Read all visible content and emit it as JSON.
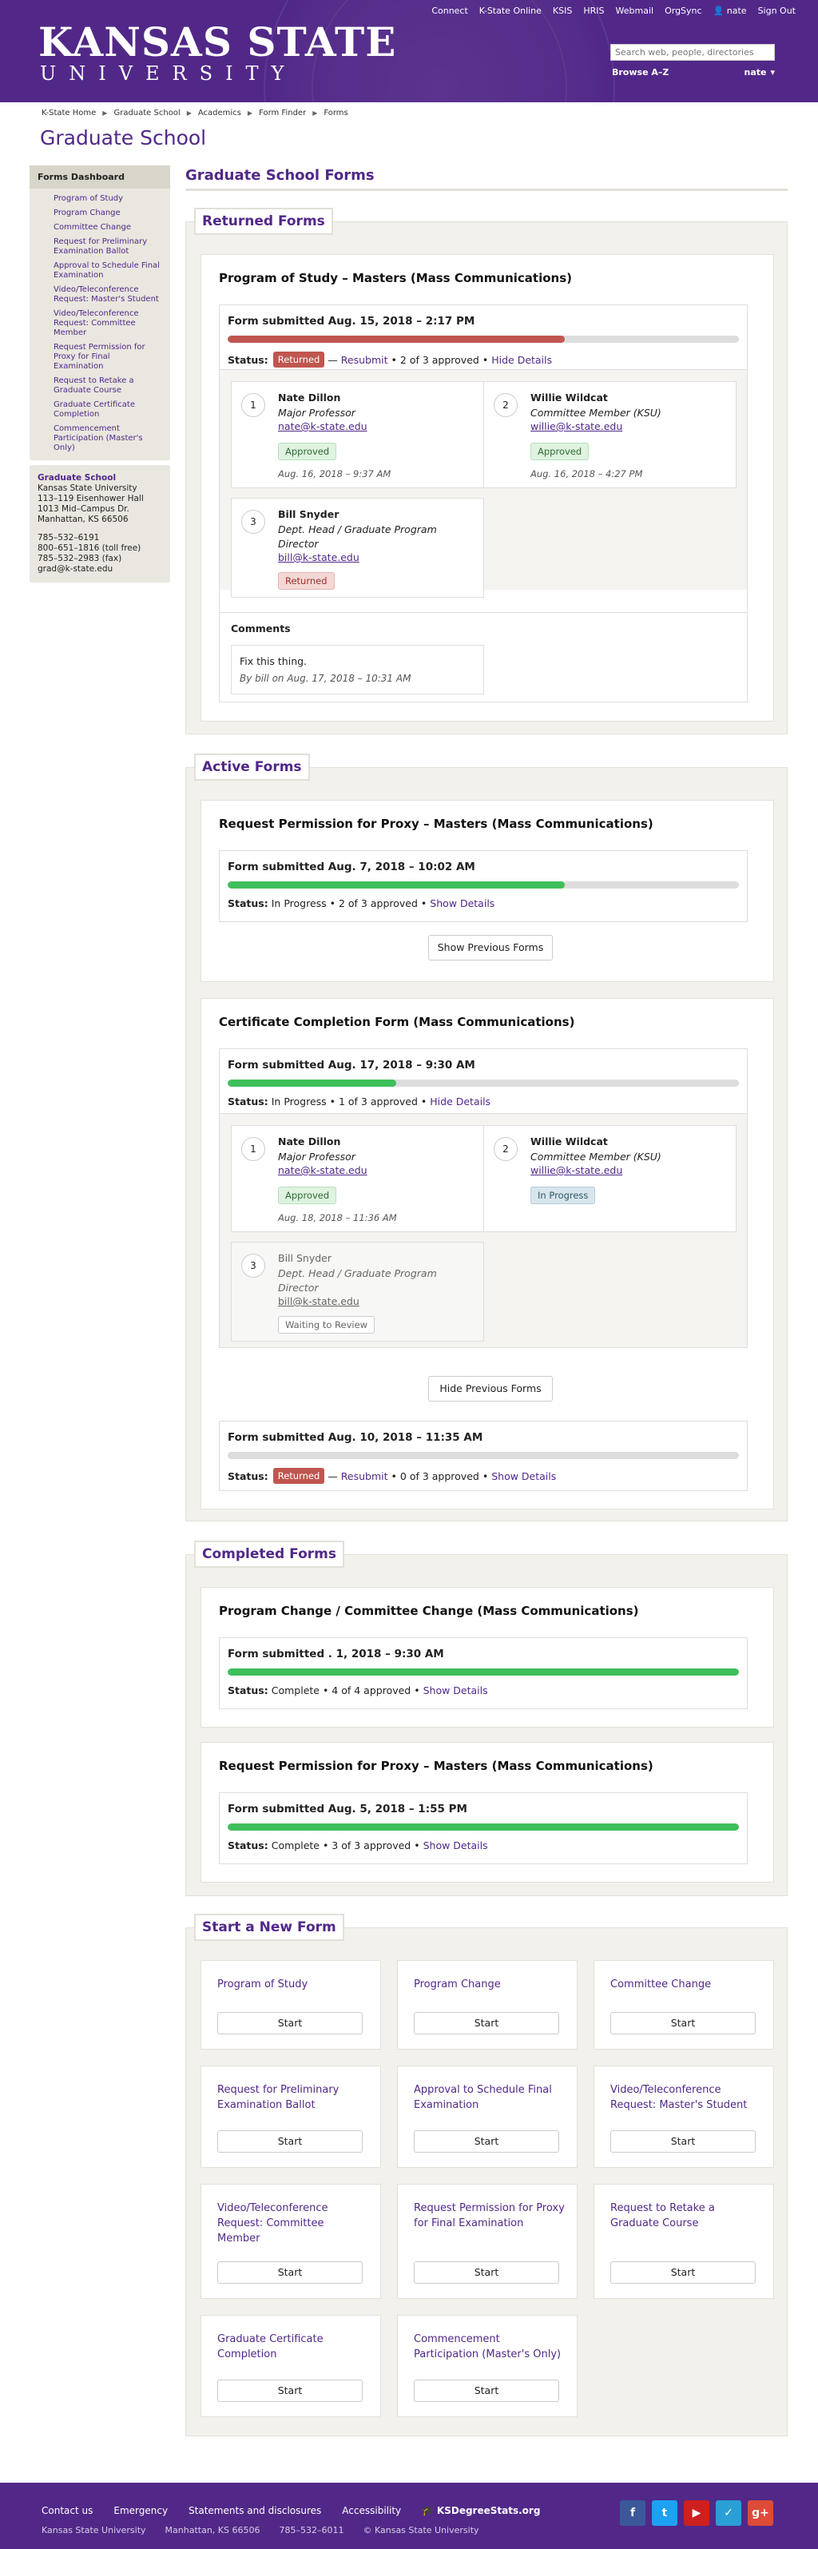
{
  "header": {
    "util_links": [
      "Connect",
      "K-State Online",
      "KSIS",
      "HRIS",
      "Webmail",
      "OrgSync"
    ],
    "user": "nate",
    "sign_out": "Sign Out",
    "logo_line1": "KANSAS STATE",
    "logo_line2": "UNIVERSITY",
    "search_placeholder": "Search web, people, directories",
    "browse": "Browse A–Z",
    "user_menu": "nate"
  },
  "breadcrumb": [
    "K-State Home",
    "Graduate School",
    "Academics",
    "Form Finder",
    "Forms"
  ],
  "site_title": "Graduate School",
  "sidebar": {
    "heading": "Forms Dashboard",
    "items": [
      "Program of Study",
      "Program Change",
      "Committee Change",
      "Request for Preliminary Examination Ballot",
      "Approval to Schedule Final Examination",
      "Video/Teleconference Request: Master's Student",
      "Video/Teleconference Request: Committee Member",
      "Request Permission for Proxy for Final Examination",
      "Request to Retake a Graduate Course",
      "Graduate Certificate Completion",
      "Commencement Participation (Master's Only)"
    ],
    "contact_title": "Graduate School",
    "contact_lines": [
      "Kansas State University",
      "113–119 Eisenhower Hall",
      "1013 Mid–Campus Dr.",
      "Manhattan, KS 66506",
      "",
      "785–532–6191",
      "800–651–1816 (toll free)",
      "785–532–2983 (fax)",
      "grad@k-state.edu"
    ]
  },
  "page_heading": "Graduate School Forms",
  "returned": {
    "title": "Returned Forms",
    "form_title": "Program of Study – Masters (Mass Communications)",
    "submitted": "Form submitted Aug. 15, 2018 – 2:17 PM",
    "progress": 0.66,
    "status_label": "Status:",
    "badge": "Returned",
    "resubmit": "Resubmit",
    "approved": "2 of 3 approved",
    "details_link": "Hide Details",
    "approvers": [
      {
        "num": "1",
        "name": "Nate Dillon",
        "role": "Major Professor",
        "email": "nate@k-state.edu",
        "status": "Approved",
        "date": "Aug. 16, 2018 – 9:37 AM"
      },
      {
        "num": "2",
        "name": "Willie Wildcat",
        "role": "Committee Member (KSU)",
        "email": "willie@k-state.edu",
        "status": "Approved",
        "date": "Aug. 16, 2018 – 4:27 PM"
      },
      {
        "num": "3",
        "name": "Bill Snyder",
        "role": "Dept. Head / Graduate Program Director",
        "email": "bill@k-state.edu",
        "status": "Returned"
      }
    ],
    "comments_title": "Comments",
    "comment_text": "Fix this thing.",
    "comment_by": "By bill on Aug. 17, 2018 – 10:31 AM"
  },
  "active": {
    "title": "Active Forms",
    "proxy": {
      "form_title": "Request Permission for Proxy – Masters (Mass Communications)",
      "submitted": "Form submitted Aug. 7, 2018 – 10:02 AM",
      "progress": 0.66,
      "status_label": "Status:",
      "status_text": "In Progress • 2 of 3 approved •",
      "details_link": "Show Details",
      "prev_button": "Show Previous Forms"
    },
    "cert": {
      "form_title": "Certificate Completion Form (Mass Communications)",
      "submitted": "Form submitted Aug. 17, 2018 – 9:30 AM",
      "progress": 0.33,
      "status_label": "Status:",
      "status_text": "In Progress • 1 of 3 approved •",
      "details_link": "Hide Details",
      "approvers": [
        {
          "num": "1",
          "name": "Nate Dillon",
          "role": "Major Professor",
          "email": "nate@k-state.edu",
          "status": "Approved",
          "date": "Aug. 18, 2018 – 11:36 AM"
        },
        {
          "num": "2",
          "name": "Willie Wildcat",
          "role": "Committee Member (KSU)",
          "email": "willie@k-state.edu",
          "status": "In Progress"
        },
        {
          "num": "3",
          "name": "Bill Snyder",
          "role": "Dept. Head / Graduate Program Director",
          "email": "bill@k-state.edu",
          "status": "Waiting to Review"
        }
      ],
      "prev_button": "Hide Previous Forms",
      "previous": {
        "submitted": "Form submitted Aug. 10, 2018 – 11:35 AM",
        "progress": 0,
        "status_label": "Status:",
        "badge": "Returned",
        "resubmit": "Resubmit",
        "approved": "0 of 3 approved",
        "details_link": "Show Details"
      }
    }
  },
  "completed": {
    "title": "Completed Forms",
    "forms": [
      {
        "form_title": "Program Change / Committee Change (Mass Communications)",
        "submitted": "Form submitted . 1, 2018 – 9:30 AM",
        "progress": 1,
        "status_label": "Status:",
        "status_text": "Complete • 4 of 4 approved •",
        "details_link": "Show Details"
      },
      {
        "form_title": "Request Permission for Proxy – Masters (Mass Communications)",
        "submitted": "Form submitted Aug. 5, 2018 – 1:55 PM",
        "progress": 1,
        "status_label": "Status:",
        "status_text": "Complete • 3 of 3 approved •",
        "details_link": "Show Details"
      }
    ]
  },
  "start": {
    "title": "Start a New Form",
    "button": "Start",
    "forms": [
      "Program of Study",
      "Program Change",
      "Committee Change",
      "Request for Preliminary Examination Ballot",
      "Approval to Schedule Final Examination",
      "Video/Teleconference Request: Master's Student",
      "Video/Teleconference Request: Committee Member",
      "Request Permission for Proxy for Final Examination",
      "Request to Retake a Graduate Course",
      "Graduate Certificate Completion",
      "Commencement Participation (Master's Only)"
    ]
  },
  "footer": {
    "links": [
      "Contact us",
      "Emergency",
      "Statements and disclosures",
      "Accessibility"
    ],
    "stats": "KSDegreeStats.org",
    "info": [
      "Kansas State University",
      "Manhattan, KS 66506",
      "785–532–6011",
      "© Kansas State University"
    ],
    "social": [
      {
        "icon": "facebook-icon",
        "glyph": "f",
        "color": "#3b5998"
      },
      {
        "icon": "twitter-icon",
        "glyph": "t",
        "color": "#1da1f2"
      },
      {
        "icon": "youtube-icon",
        "glyph": "▶",
        "color": "#cd201f"
      },
      {
        "icon": "checkmark-icon",
        "glyph": "✓",
        "color": "#2a9fd6"
      },
      {
        "icon": "googleplus-icon",
        "glyph": "g+",
        "color": "#dd4b39"
      }
    ]
  }
}
